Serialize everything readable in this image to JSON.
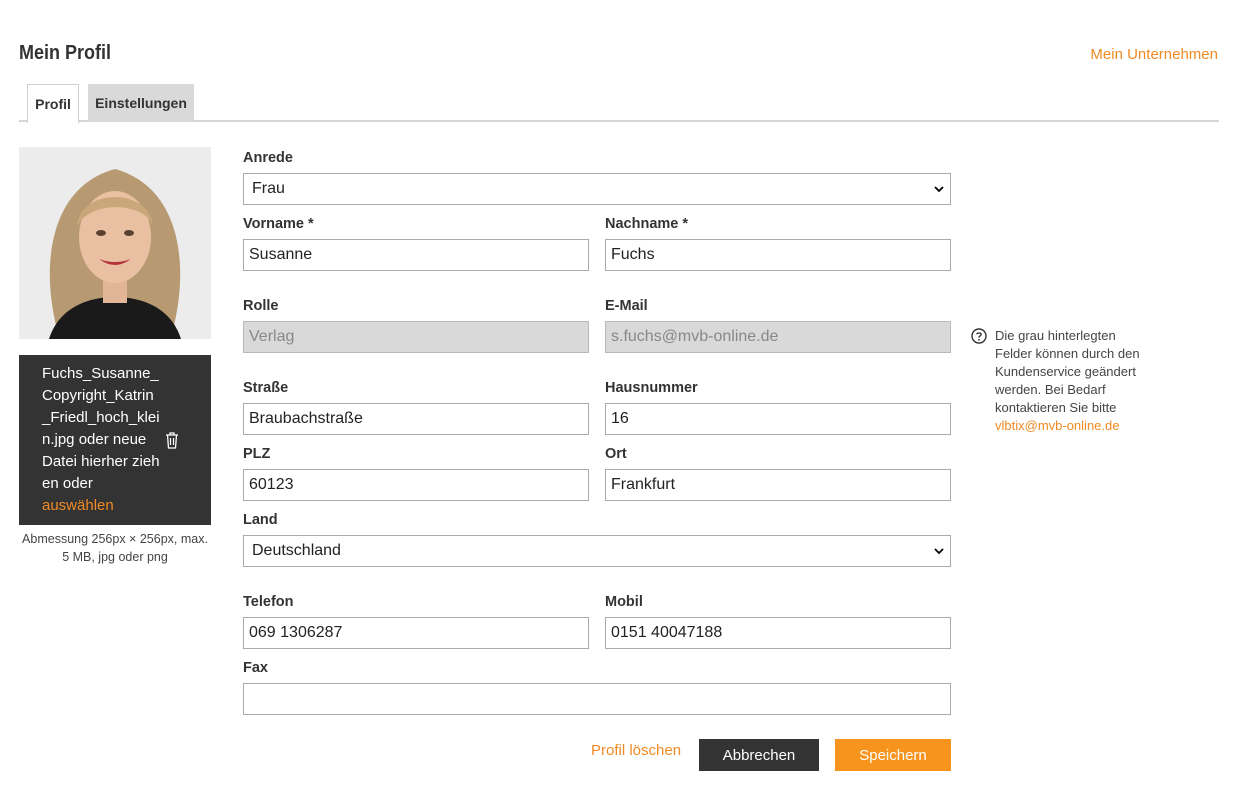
{
  "header": {
    "title": "Mein Profil",
    "company_link": "Mein Unternehmen"
  },
  "tabs": [
    {
      "label": "Profil",
      "active": true
    },
    {
      "label": "Einstellungen",
      "active": false
    }
  ],
  "upload": {
    "text": "Fuchs_Susanne_Copyright_Katrin_Friedl_hoch_klein.jpg oder neue Datei hierher ziehen oder ",
    "link": "auswählen",
    "hint": "Abmessung 256px × 256px, max. 5 MB, jpg oder png"
  },
  "form": {
    "anrede": {
      "label": "Anrede",
      "value": "Frau"
    },
    "vorname": {
      "label": "Vorname *",
      "value": "Susanne"
    },
    "nachname": {
      "label": "Nachname *",
      "value": "Fuchs"
    },
    "rolle": {
      "label": "Rolle",
      "value": "Verlag"
    },
    "email": {
      "label": "E-Mail",
      "value": "s.fuchs@mvb-online.de"
    },
    "strasse": {
      "label": "Straße",
      "value": "Braubachstraße"
    },
    "hausnummer": {
      "label": "Hausnummer",
      "value": "16"
    },
    "plz": {
      "label": "PLZ",
      "value": "60123"
    },
    "ort": {
      "label": "Ort",
      "value": "Frankfurt"
    },
    "land": {
      "label": "Land",
      "value": "Deutschland"
    },
    "telefon": {
      "label": "Telefon",
      "value": "069 1306287"
    },
    "mobil": {
      "label": "Mobil",
      "value": "0151 40047188"
    },
    "fax": {
      "label": "Fax",
      "value": ""
    }
  },
  "info": {
    "text": "Die grau hinterlegten Felder können durch den Kundenservice geändert werden. Bei Bedarf kontaktieren Sie bitte",
    "email": "vlbtix@mvb-online.de"
  },
  "actions": {
    "delete": "Profil löschen",
    "cancel": "Abbrechen",
    "save": "Speichern"
  },
  "colors": {
    "accent": "#f08a24",
    "save_button": "#f7941d",
    "dark": "#333333",
    "readonly_bg": "#d9d9d9"
  }
}
